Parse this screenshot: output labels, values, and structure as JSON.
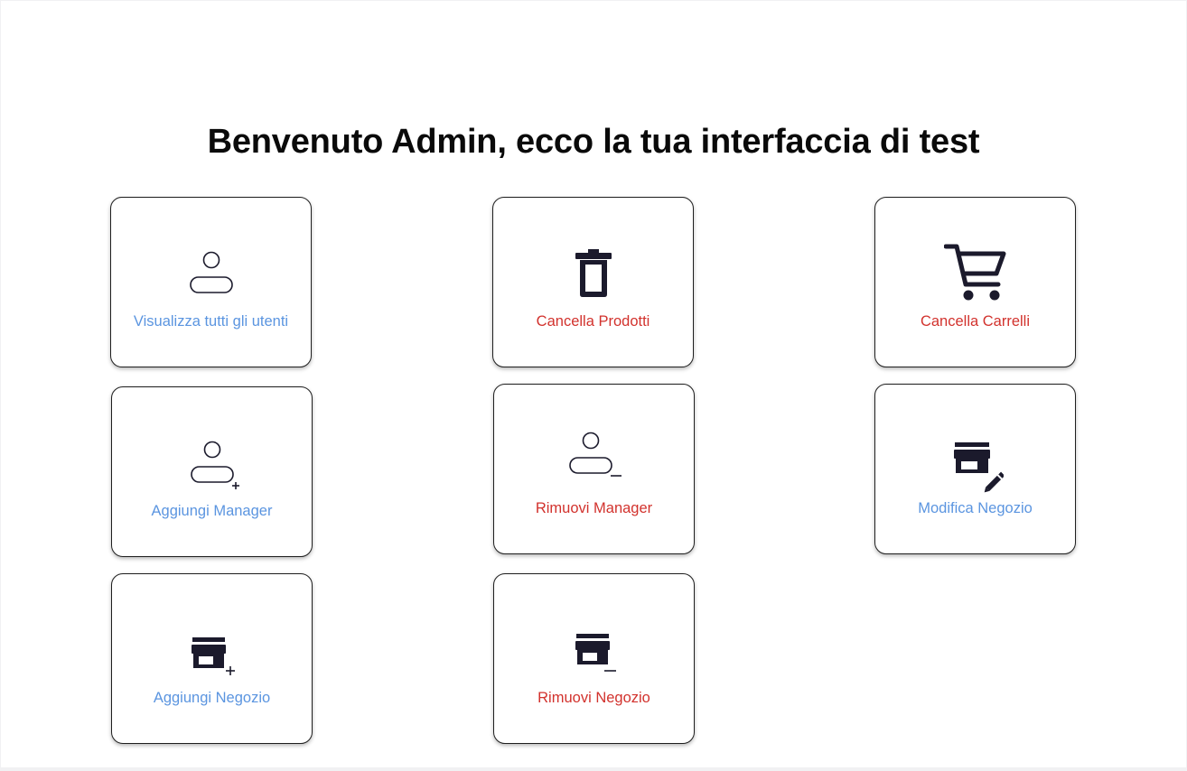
{
  "header": {
    "title": "Benvenuto Admin, ecco la tua interfaccia di test"
  },
  "colors": {
    "blue_label": "#5b95e0",
    "red_label": "#d2322d",
    "icon": "#1b1a2c"
  },
  "cards": [
    {
      "label": "Visualizza tutti gli utenti",
      "icon": "user-icon",
      "color": "blue"
    },
    {
      "label": "Cancella Prodotti",
      "icon": "trash-icon",
      "color": "red"
    },
    {
      "label": "Cancella Carrelli",
      "icon": "cart-icon",
      "color": "red"
    },
    {
      "label": "Aggiungi Manager",
      "icon": "user-add-icon",
      "color": "blue"
    },
    {
      "label": "Rimuovi Manager",
      "icon": "user-remove-icon",
      "color": "red"
    },
    {
      "label": "Modifica Negozio",
      "icon": "store-edit-icon",
      "color": "blue"
    },
    {
      "label": "Aggiungi Negozio",
      "icon": "store-add-icon",
      "color": "blue"
    },
    {
      "label": "Rimuovi Negozio",
      "icon": "store-remove-icon",
      "color": "red"
    }
  ]
}
